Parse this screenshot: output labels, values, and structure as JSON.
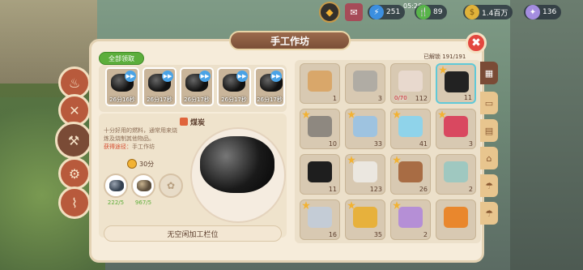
{
  "header": {
    "time": "05:26",
    "stamina": "251",
    "battery": "89",
    "coins": "1.4百万",
    "gems": "136"
  },
  "panel": {
    "title": "手工作坊",
    "collect_all": "全部领取",
    "unlocked": "已解锁 191/191"
  },
  "queue": [
    {
      "time": "26分16秒"
    },
    {
      "time": "26分17秒"
    },
    {
      "time": "26分17秒"
    },
    {
      "time": "26分17秒"
    },
    {
      "time": "26分17秒"
    }
  ],
  "detail": {
    "name": "煤炭",
    "desc1": "十分好用的燃料，通常用来烧",
    "desc2": "炼及烧制其他物品。",
    "source_label": "获得途径：",
    "source": "手工作坊",
    "time": "30分",
    "mat1": "222/5",
    "mat2": "967/5",
    "no_slot": "无空闲加工栏位"
  },
  "items": [
    {
      "count": "1",
      "color": "#d9a76a"
    },
    {
      "count": "3",
      "color": "#b0aca4"
    },
    {
      "count": "112",
      "color": "#e8d9ce",
      "locked": "0/70"
    },
    {
      "count": "11",
      "color": "#222"
    },
    {
      "count": "10",
      "color": "#8e8880"
    },
    {
      "count": "33",
      "color": "#9ec3e0"
    },
    {
      "count": "41",
      "color": "#8fd3ea"
    },
    {
      "count": "3",
      "color": "#d94860"
    },
    {
      "count": "11",
      "color": "#1e1e1e"
    },
    {
      "count": "123",
      "color": "#ebe7e0"
    },
    {
      "count": "26",
      "color": "#a86c44"
    },
    {
      "count": "2",
      "color": "#9fc8c0"
    },
    {
      "count": "16",
      "color": "#c4ccd6"
    },
    {
      "count": "35",
      "color": "#e7b13c"
    },
    {
      "count": "2",
      "color": "#b58fd6"
    },
    {
      "count": "",
      "color": "#e9872d"
    }
  ]
}
